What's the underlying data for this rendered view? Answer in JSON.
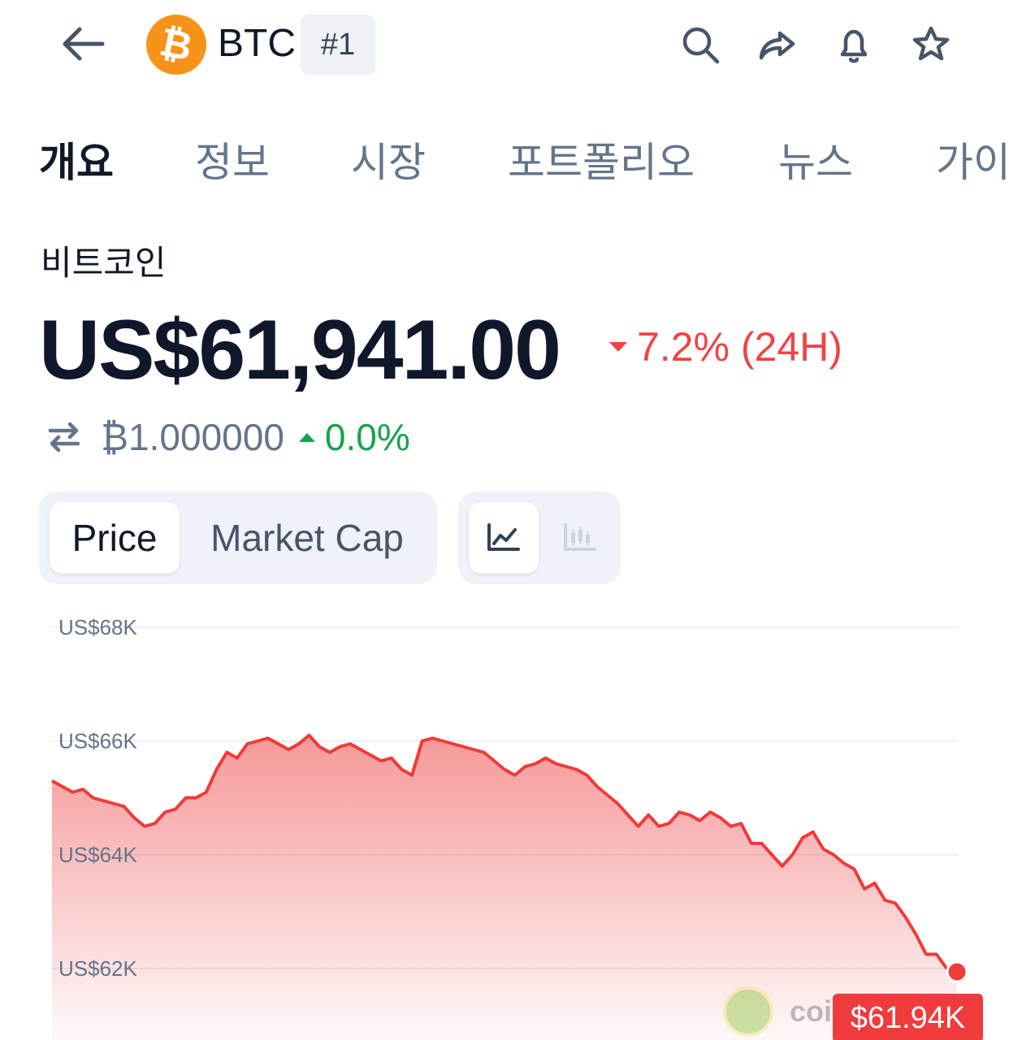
{
  "header": {
    "symbol": "BTC",
    "rank": "#1",
    "coin_logo_glyph": "₿",
    "icons": [
      "back-arrow-icon",
      "search-icon",
      "share-icon",
      "bell-icon",
      "star-icon"
    ]
  },
  "tabs": [
    "개요",
    "정보",
    "시장",
    "포트폴리오",
    "뉴스",
    "가이"
  ],
  "active_tab": "개요",
  "coin": {
    "name": "비트코인",
    "price": "US$61,941.00",
    "change_24h": "7.2% (24H)",
    "change_direction": "down",
    "btc_value": "₿1.000000",
    "btc_change": "0.0%",
    "btc_change_direction": "up"
  },
  "toggles": {
    "metric_options": [
      "Price",
      "Market Cap"
    ],
    "selected_metric": "Price",
    "chart_type_icons": [
      "line-chart-icon",
      "candlestick-chart-icon"
    ],
    "selected_chart_type": "line-chart-icon"
  },
  "colors": {
    "line": "#ef3b3b",
    "down": "#ef4444",
    "up": "#16a34a",
    "brand": "#f7931a"
  },
  "chart_data": {
    "type": "area",
    "ylim": [
      61000,
      68500
    ],
    "yticks": [
      68000,
      66000,
      64000,
      62000
    ],
    "ytick_labels": [
      "US$68K",
      "US$66K",
      "US$64K",
      "US$62K"
    ],
    "last_value_label": "$61.94K",
    "grid": true,
    "values": [
      65300,
      65200,
      65100,
      65150,
      65000,
      64950,
      64900,
      64850,
      64650,
      64500,
      64550,
      64750,
      64800,
      65000,
      65000,
      65100,
      65500,
      65800,
      65700,
      65950,
      66000,
      66050,
      65950,
      65850,
      65950,
      66100,
      65900,
      65800,
      65900,
      65950,
      65850,
      65750,
      65650,
      65700,
      65500,
      65400,
      66000,
      66050,
      66000,
      65950,
      65900,
      65850,
      65800,
      65650,
      65500,
      65400,
      65550,
      65600,
      65700,
      65600,
      65550,
      65500,
      65400,
      65200,
      65050,
      64900,
      64700,
      64500,
      64700,
      64500,
      64550,
      64750,
      64700,
      64600,
      64750,
      64650,
      64500,
      64550,
      64200,
      64200,
      64000,
      63800,
      64000,
      64300,
      64400,
      64100,
      64000,
      63850,
      63750,
      63400,
      63500,
      63200,
      63150,
      62900,
      62600,
      62250,
      62250,
      62000,
      61941
    ]
  }
}
